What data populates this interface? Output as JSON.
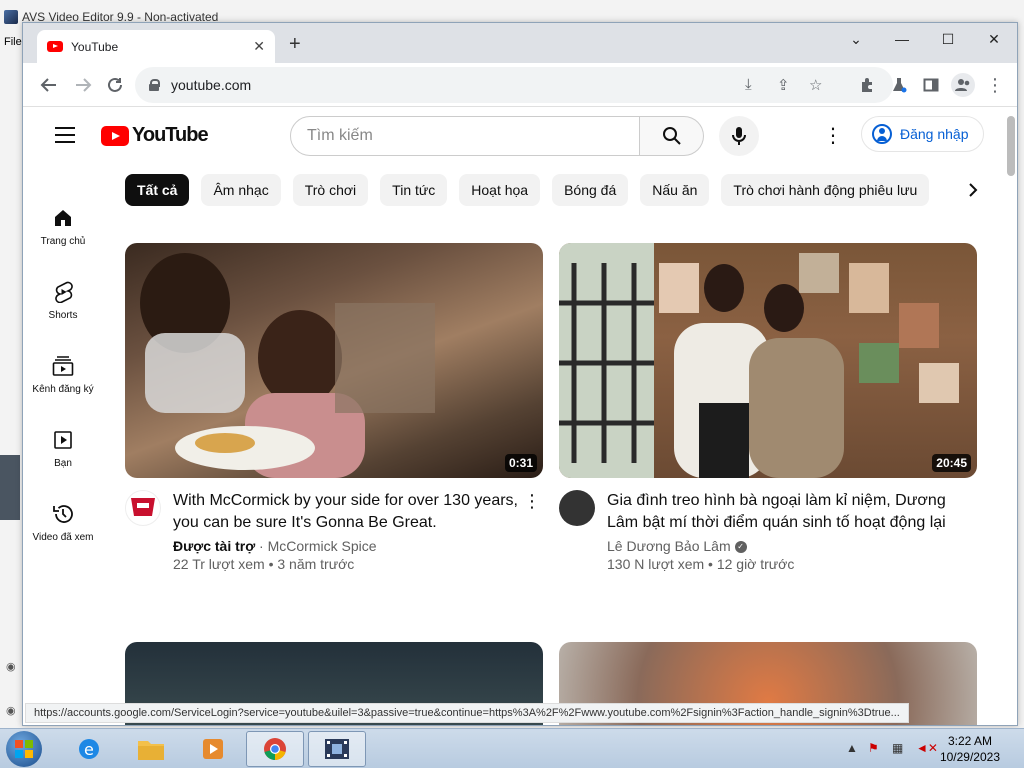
{
  "background_app": {
    "title": "AVS Video Editor 9.9 - Non-activated",
    "menu_file": "File"
  },
  "browser": {
    "tab_title": "YouTube",
    "url": "youtube.com",
    "status_url": "https://accounts.google.com/ServiceLogin?service=youtube&uilel=3&passive=true&continue=https%3A%2F%2Fwww.youtube.com%2Fsignin%3Faction_handle_signin%3Dtrue..."
  },
  "youtube": {
    "search_placeholder": "Tìm kiếm",
    "sign_in": "Đăng nhập",
    "logo_text": "YouTube",
    "nav": [
      {
        "label": "Trang chủ",
        "icon": "home-icon"
      },
      {
        "label": "Shorts",
        "icon": "shorts-icon"
      },
      {
        "label": "Kênh đăng ký",
        "icon": "subscriptions-icon"
      },
      {
        "label": "Bạn",
        "icon": "you-icon"
      },
      {
        "label": "Video đã xem",
        "icon": "history-icon"
      }
    ],
    "chips": [
      "Tất cả",
      "Âm nhạc",
      "Trò chơi",
      "Tin tức",
      "Hoạt họa",
      "Bóng đá",
      "Nấu ăn",
      "Trò chơi hành động phiêu lưu"
    ],
    "videos": [
      {
        "title": "With McCormick by your side for over 130 years, you can be sure It's Gonna Be Great.",
        "sponsored": "Được tài trợ",
        "channel": "McCormick Spice",
        "stats": "22 Tr lượt xem • 3 năm trước",
        "duration": "0:31"
      },
      {
        "title": "Gia đình treo hình bà ngoại làm kỉ niệm, Dương Lâm bật mí thời điểm quán sinh tố hoạt động lại",
        "channel": "Lê Dương Bảo Lâm",
        "stats": "130 N lượt xem • 12 giờ trước",
        "duration": "20:45"
      }
    ]
  },
  "taskbar": {
    "time": "3:22 AM",
    "date": "10/29/2023"
  },
  "colors": {
    "youtube_red": "#ff0000",
    "link_blue": "#065fd4"
  }
}
